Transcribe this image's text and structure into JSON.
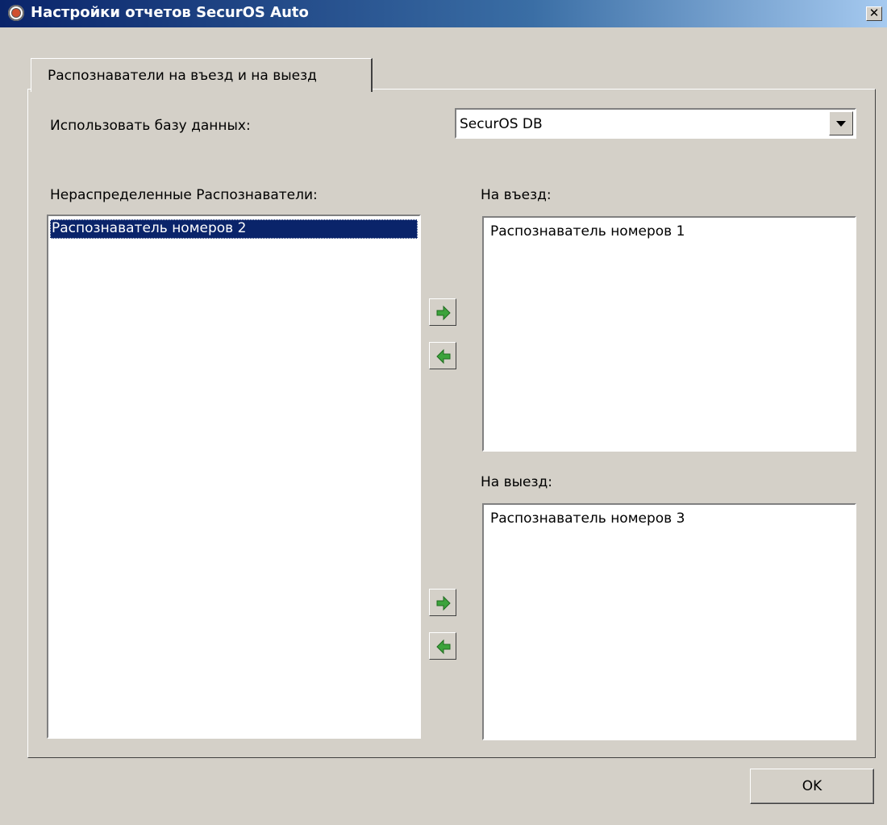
{
  "window": {
    "title": "Настройки отчетов SecurOS Auto",
    "close_glyph": "✕"
  },
  "tabs": [
    {
      "label": "Распознаватели на въезд и на выезд",
      "selected": true
    }
  ],
  "database": {
    "label": "Использовать базу данных:",
    "value": "SecurOS DB"
  },
  "unassigned": {
    "label": "Нераспределенные Распознаватели:",
    "items": [
      {
        "text": "Распознаватель номеров 2",
        "selected": true
      }
    ]
  },
  "entry": {
    "label": "На въезд:",
    "items": [
      {
        "text": "Распознаватель номеров 1"
      }
    ]
  },
  "exit": {
    "label": "На выезд:",
    "items": [
      {
        "text": "Распознаватель номеров 3"
      }
    ]
  },
  "buttons": {
    "ok": "OK"
  },
  "icons": {
    "app": "securos-app-icon",
    "move_right": "green-arrow-right-icon",
    "move_left": "green-arrow-left-icon"
  },
  "colors": {
    "title_start": "#0a246a",
    "title_end": "#a6caf0",
    "selection": "#0a246a",
    "face": "#d4d0c8",
    "arrow": "#3ca33c"
  }
}
